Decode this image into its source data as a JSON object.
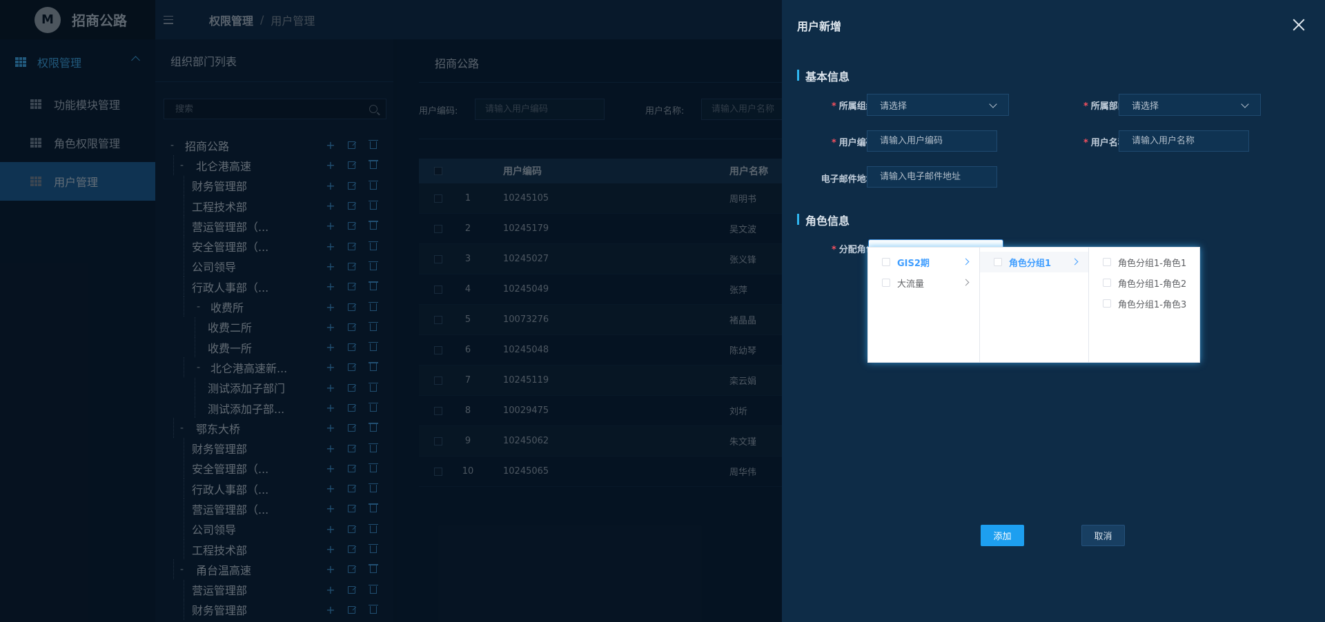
{
  "app": {
    "logo_text": "招商公路",
    "logo_glyph": "M"
  },
  "sidebar": {
    "group_label": "权限管理",
    "items": [
      {
        "label": "功能模块管理",
        "active": false
      },
      {
        "label": "角色权限管理",
        "active": false
      },
      {
        "label": "用户管理",
        "active": true
      }
    ]
  },
  "breadcrumb": {
    "main": "权限管理",
    "sep": "/",
    "sub": "用户管理"
  },
  "org_panel": {
    "title": "组织部门列表",
    "search_placeholder": "搜索",
    "tree": [
      {
        "label": "招商公路",
        "level": 0,
        "toggle": "-"
      },
      {
        "label": "北仑港高速",
        "level": 1,
        "toggle": "-"
      },
      {
        "label": "财务管理部",
        "level": 2,
        "toggle": ""
      },
      {
        "label": "工程技术部",
        "level": 2,
        "toggle": ""
      },
      {
        "label": "营运管理部（...",
        "level": 2,
        "toggle": ""
      },
      {
        "label": "安全管理部（...",
        "level": 2,
        "toggle": ""
      },
      {
        "label": "公司领导",
        "level": 2,
        "toggle": ""
      },
      {
        "label": "行政人事部（...",
        "level": 2,
        "toggle": ""
      },
      {
        "label": "收费所",
        "level": 2,
        "toggle": "-"
      },
      {
        "label": "收费二所",
        "level": 3,
        "toggle": ""
      },
      {
        "label": "收费一所",
        "level": 3,
        "toggle": ""
      },
      {
        "label": "北仑港高速新...",
        "level": 2,
        "toggle": "-"
      },
      {
        "label": "测试添加子部门",
        "level": 3,
        "toggle": ""
      },
      {
        "label": "测试添加子部...",
        "level": 3,
        "toggle": ""
      },
      {
        "label": "鄂东大桥",
        "level": 1,
        "toggle": "-"
      },
      {
        "label": "财务管理部",
        "level": 2,
        "toggle": ""
      },
      {
        "label": "安全管理部（...",
        "level": 2,
        "toggle": ""
      },
      {
        "label": "行政人事部（...",
        "level": 2,
        "toggle": ""
      },
      {
        "label": "营运管理部（...",
        "level": 2,
        "toggle": ""
      },
      {
        "label": "公司领导",
        "level": 2,
        "toggle": ""
      },
      {
        "label": "工程技术部",
        "level": 2,
        "toggle": ""
      },
      {
        "label": "甬台温高速",
        "level": 1,
        "toggle": "-"
      },
      {
        "label": "营运管理部",
        "level": 2,
        "toggle": ""
      },
      {
        "label": "财务管理部",
        "level": 2,
        "toggle": ""
      }
    ]
  },
  "main": {
    "title": "招商公路",
    "filters": {
      "code_label": "用户编码:",
      "code_placeholder": "请输入用户编码",
      "name_label": "用户名称:",
      "name_placeholder": "请输入用户名称"
    },
    "table": {
      "headers": {
        "code": "用户编码",
        "name": "用户名称"
      },
      "rows": [
        {
          "idx": "1",
          "code": "10245105",
          "name": "周明书"
        },
        {
          "idx": "2",
          "code": "10245179",
          "name": "吴文波"
        },
        {
          "idx": "3",
          "code": "10245027",
          "name": "张义锋"
        },
        {
          "idx": "4",
          "code": "10245049",
          "name": "张萍"
        },
        {
          "idx": "5",
          "code": "10073276",
          "name": "褚晶晶"
        },
        {
          "idx": "6",
          "code": "10245048",
          "name": "陈幼琴"
        },
        {
          "idx": "7",
          "code": "10245119",
          "name": "栾云娟"
        },
        {
          "idx": "8",
          "code": "10029475",
          "name": "刘圻"
        },
        {
          "idx": "9",
          "code": "10245062",
          "name": "朱文瑾"
        },
        {
          "idx": "10",
          "code": "10245065",
          "name": "周华伟"
        }
      ]
    }
  },
  "drawer": {
    "title": "用户新增",
    "basic_section": "基本信息",
    "role_section": "角色信息",
    "required_mark": "*",
    "fields": {
      "org_label": "所属组织:",
      "org_value": "请选择",
      "dept_label": "所属部门:",
      "dept_value": "请选择",
      "code_label": "用户编码:",
      "code_placeholder": "请输入用户编码",
      "name_label": "用户名称:",
      "name_placeholder": "请输入用户名称",
      "email_label": "电子邮件地址:",
      "email_placeholder": "请输入电子邮件地址",
      "role_label": "分配角色:"
    },
    "cascader": {
      "col1": [
        {
          "label": "GIS2期",
          "selected": true
        },
        {
          "label": "大流量",
          "selected": false
        }
      ],
      "col2": [
        {
          "label": "角色分组1",
          "selected": true
        }
      ],
      "col3": [
        {
          "label": "角色分组1-角色1"
        },
        {
          "label": "角色分组1-角色2"
        },
        {
          "label": "角色分组1-角色3"
        }
      ]
    },
    "add_button": "添加",
    "cancel_button": "取消"
  },
  "colors": {
    "accent": "#1d9ff0",
    "sidebar_active": "#1c5a8c",
    "cascader_selected": "#409eff",
    "required": "#f5515f"
  }
}
